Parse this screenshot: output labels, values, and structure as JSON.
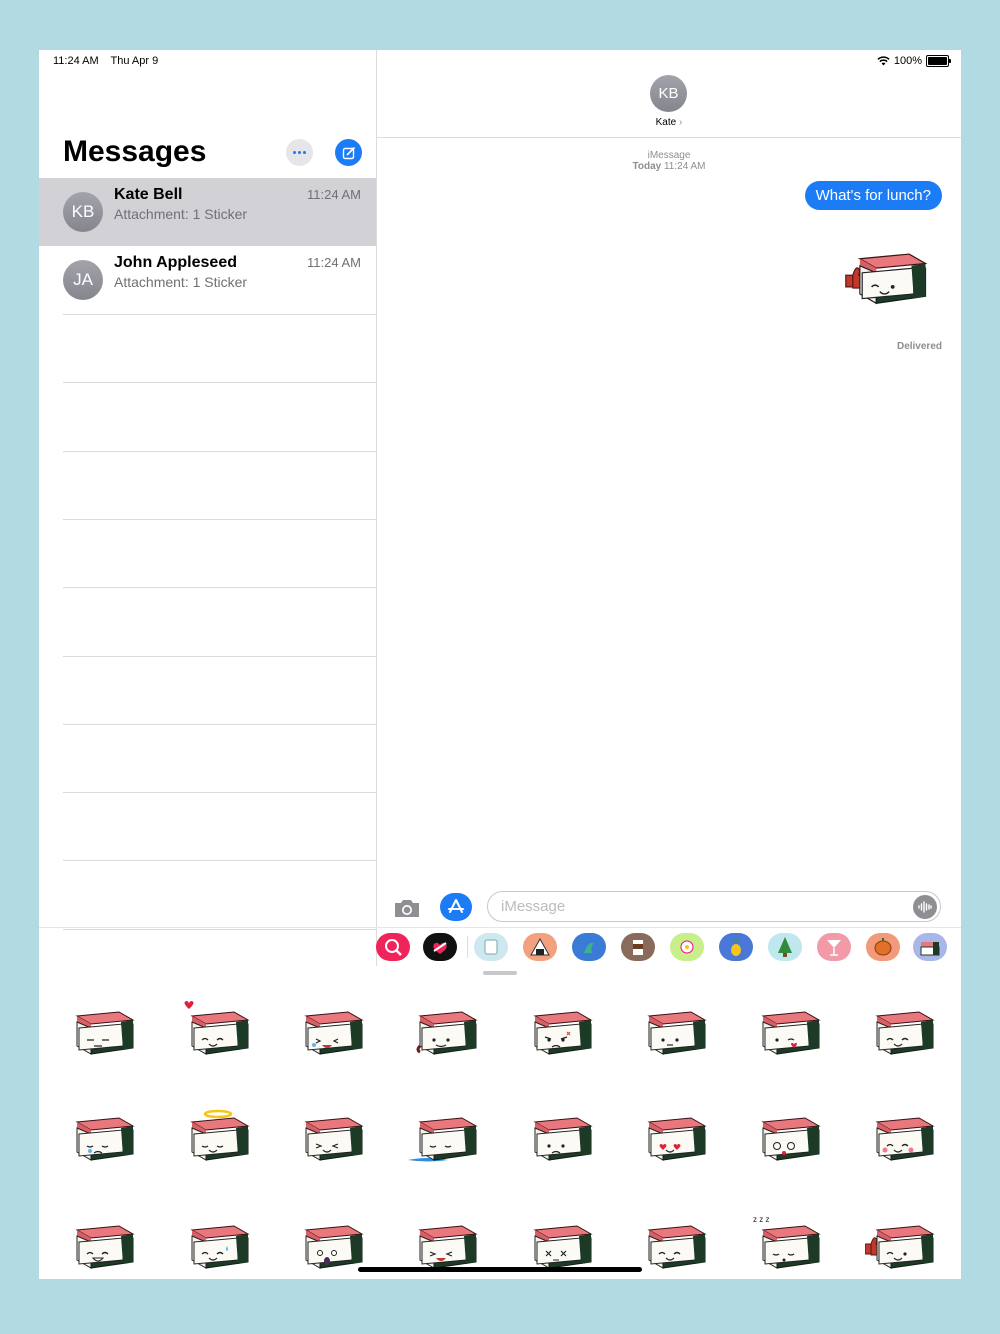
{
  "status_bar": {
    "time": "11:24 AM",
    "date": "Thu Apr 9",
    "battery": "100%",
    "battery_level": 1.0
  },
  "sidebar": {
    "title": "Messages",
    "conversations": [
      {
        "initials": "KB",
        "name": "Kate Bell",
        "preview": "Attachment: 1 Sticker",
        "time": "11:24 AM",
        "selected": true
      },
      {
        "initials": "JA",
        "name": "John Appleseed",
        "preview": "Attachment: 1 Sticker",
        "time": "11:24 AM",
        "selected": false
      }
    ]
  },
  "chat": {
    "contact_initials": "KB",
    "contact_name": "Kate",
    "service": "iMessage",
    "timestamp_day": "Today",
    "timestamp_time": "11:24 AM",
    "message": "What's for lunch?",
    "status": "Delivered",
    "input_placeholder": "iMessage"
  },
  "app_strip": {
    "apps": [
      "search-images-icon",
      "digital-touch-icon",
      "stickers-app-icon",
      "onigiri-app-icon",
      "mermaid-app-icon",
      "coffee-app-icon",
      "flower-app-icon",
      "pineapple-app-icon",
      "tree-app-icon",
      "cocktail-app-icon",
      "pumpkin-app-icon",
      "spam-musubi-app-icon"
    ]
  },
  "stickers": {
    "rows": [
      [
        "expressionless",
        "heart",
        "laugh-tears",
        "drool",
        "angry",
        "neutral",
        "wink-kiss",
        "smile"
      ],
      [
        "crying",
        "angel",
        "squint",
        "puddle-tears",
        "sad-blue",
        "heart-eyes",
        "dizzy",
        "blush"
      ],
      [
        "grin",
        "sweat",
        "scream",
        "laugh",
        "dead",
        "smile",
        "sleepy",
        "thumbs-up"
      ]
    ]
  },
  "colors": {
    "accent": "#1b7cf6",
    "background": "#b1dae3",
    "selected_row": "#d1d1d6"
  }
}
